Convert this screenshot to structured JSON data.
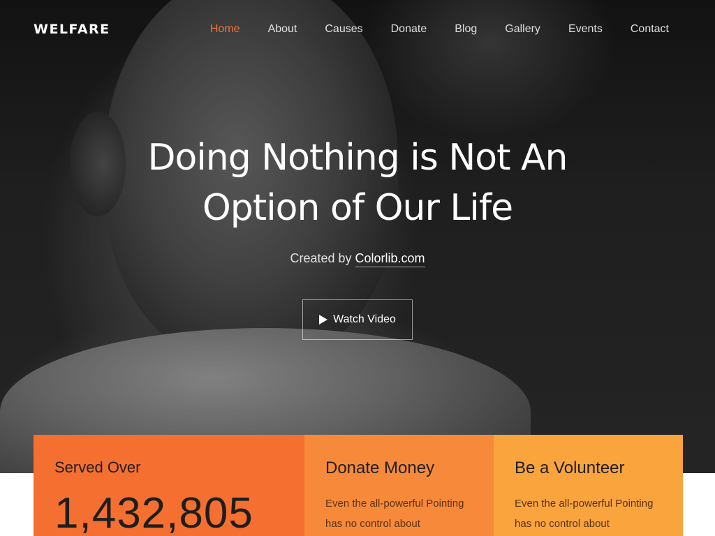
{
  "brand": "WELFARE",
  "nav": [
    {
      "label": "Home",
      "active": true
    },
    {
      "label": "About",
      "active": false
    },
    {
      "label": "Causes",
      "active": false
    },
    {
      "label": "Donate",
      "active": false
    },
    {
      "label": "Blog",
      "active": false
    },
    {
      "label": "Gallery",
      "active": false
    },
    {
      "label": "Events",
      "active": false
    },
    {
      "label": "Contact",
      "active": false
    }
  ],
  "hero": {
    "title": "Doing Nothing is Not An Option of Our Life",
    "sub_prefix": "Created by ",
    "sub_link": "Colorlib.com",
    "watch_label": "Watch Video"
  },
  "cards": [
    {
      "title": "Served Over",
      "number": "1,432,805"
    },
    {
      "title": "Donate Money",
      "text": "Even the all-powerful Pointing has no control about"
    },
    {
      "title": "Be a Volunteer",
      "text": "Even the all-powerful Pointing has no control about"
    }
  ],
  "colors": {
    "accent": "#f46f34",
    "card1": "#f46f30",
    "card2": "#f78a3a",
    "card3": "#f9a43d"
  }
}
